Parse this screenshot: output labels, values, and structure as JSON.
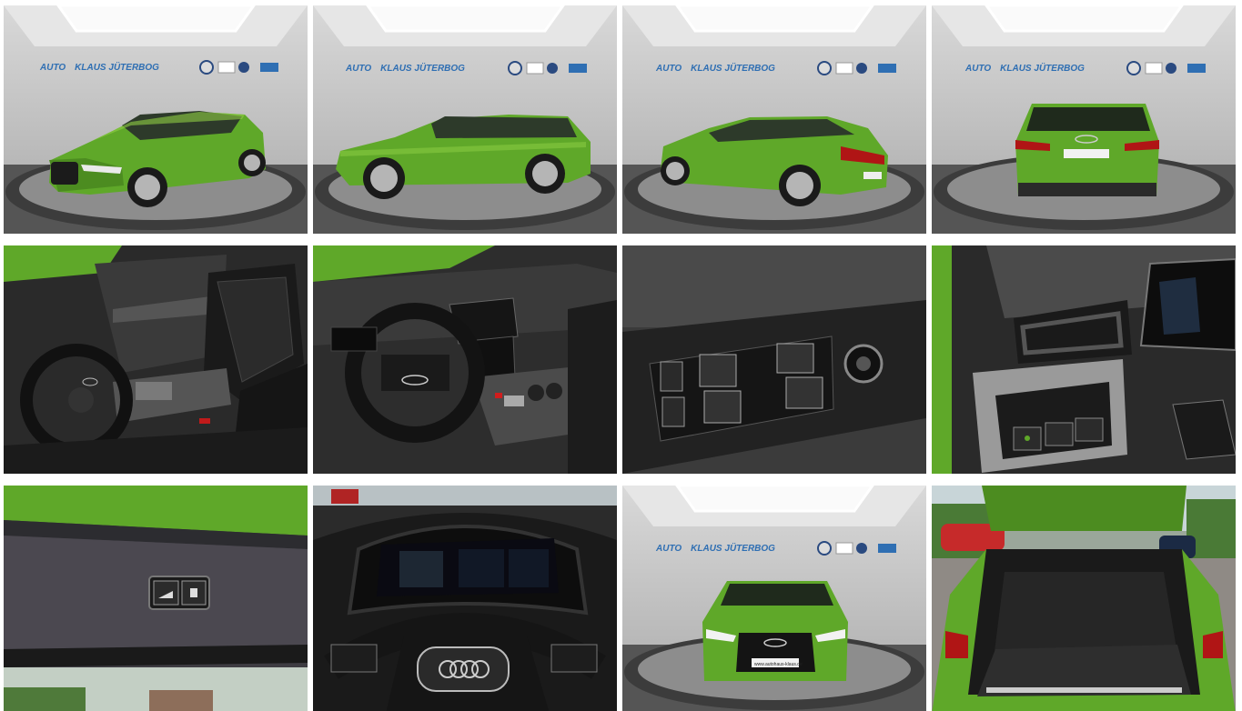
{
  "gallery": {
    "dealer_sign": {
      "part1": "AUTO",
      "part2": "KLAUS",
      "part3": "JÜTERBOG"
    },
    "plate_text": "www.autohaus-klaus.de",
    "colors": {
      "car_green": "#5fa829",
      "car_green_dark": "#3d7a18",
      "car_green_light": "#8fcf45",
      "showroom_wall": "#c9c9c9",
      "showroom_floor": "#4a4a4a",
      "turntable": "#8d8d8d",
      "interior_black": "#1e1e1e",
      "sign_blue": "#2f6fb3"
    },
    "photos": [
      {
        "id": "front-three-quarter",
        "icon": "car-front-left-icon"
      },
      {
        "id": "side-profile",
        "icon": "car-side-icon"
      },
      {
        "id": "rear-three-quarter",
        "icon": "car-rear-left-icon"
      },
      {
        "id": "rear-view",
        "icon": "car-rear-icon"
      },
      {
        "id": "driver-seat-interior",
        "icon": "car-seat-icon"
      },
      {
        "id": "dashboard-steering",
        "icon": "steering-wheel-icon"
      },
      {
        "id": "door-window-controls",
        "icon": "window-switch-icon"
      },
      {
        "id": "center-console-lights",
        "icon": "light-switch-icon"
      },
      {
        "id": "tailgate-buttons",
        "icon": "tailgate-button-icon"
      },
      {
        "id": "virtual-cockpit",
        "icon": "instrument-cluster-icon"
      },
      {
        "id": "front-view",
        "icon": "car-front-icon"
      },
      {
        "id": "open-trunk",
        "icon": "trunk-icon"
      }
    ]
  }
}
